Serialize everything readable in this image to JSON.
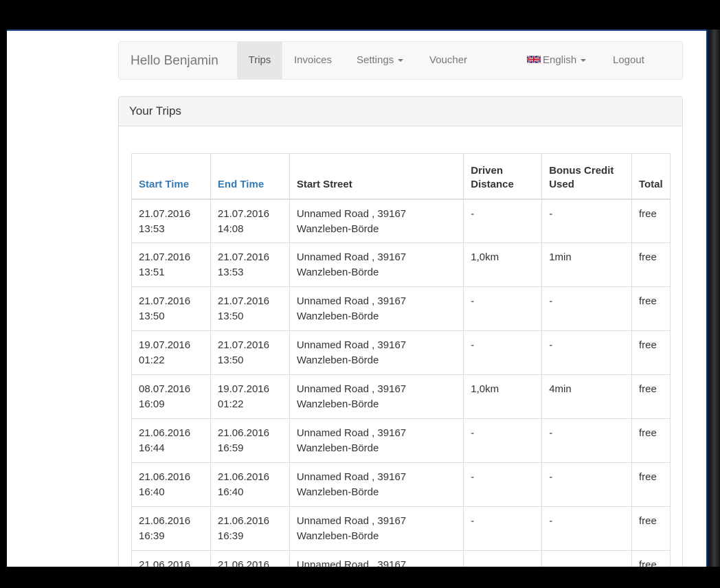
{
  "nav": {
    "brand": "Hello Benjamin",
    "trips": "Trips",
    "invoices": "Invoices",
    "settings": "Settings",
    "voucher": "Voucher",
    "language": "English",
    "logout": "Logout",
    "language_icon": "uk-flag-icon"
  },
  "panel": {
    "title": "Your Trips"
  },
  "table": {
    "headers": {
      "start_time": "Start Time",
      "end_time": "End Time",
      "start_street": "Start Street",
      "driven_1": "Driven",
      "driven_2": "Distance",
      "bonus_1": "Bonus Credit",
      "bonus_2": "Used",
      "total": "Total"
    },
    "rows": [
      {
        "start_date": "21.07.2016",
        "start_time": "13:53",
        "end_date": "21.07.2016",
        "end_time": "14:08",
        "street_1": "Unnamed Road , 39167",
        "street_2": "Wanzleben-Börde",
        "distance": "-",
        "bonus": "-",
        "total": "free"
      },
      {
        "start_date": "21.07.2016",
        "start_time": "13:51",
        "end_date": "21.07.2016",
        "end_time": "13:53",
        "street_1": "Unnamed Road , 39167",
        "street_2": "Wanzleben-Börde",
        "distance": "1,0km",
        "bonus": "1min",
        "total": "free"
      },
      {
        "start_date": "21.07.2016",
        "start_time": "13:50",
        "end_date": "21.07.2016",
        "end_time": "13:50",
        "street_1": "Unnamed Road , 39167",
        "street_2": "Wanzleben-Börde",
        "distance": "-",
        "bonus": "-",
        "total": "free"
      },
      {
        "start_date": "19.07.2016",
        "start_time": "01:22",
        "end_date": "21.07.2016",
        "end_time": "13:50",
        "street_1": "Unnamed Road , 39167",
        "street_2": "Wanzleben-Börde",
        "distance": "-",
        "bonus": "-",
        "total": "free"
      },
      {
        "start_date": "08.07.2016",
        "start_time": "16:09",
        "end_date": "19.07.2016",
        "end_time": "01:22",
        "street_1": "Unnamed Road , 39167",
        "street_2": "Wanzleben-Börde",
        "distance": "1,0km",
        "bonus": "4min",
        "total": "free"
      },
      {
        "start_date": "21.06.2016",
        "start_time": "16:44",
        "end_date": "21.06.2016",
        "end_time": "16:59",
        "street_1": "Unnamed Road , 39167",
        "street_2": "Wanzleben-Börde",
        "distance": "-",
        "bonus": "-",
        "total": "free"
      },
      {
        "start_date": "21.06.2016",
        "start_time": "16:40",
        "end_date": "21.06.2016",
        "end_time": "16:40",
        "street_1": "Unnamed Road , 39167",
        "street_2": "Wanzleben-Börde",
        "distance": "-",
        "bonus": "-",
        "total": "free"
      },
      {
        "start_date": "21.06.2016",
        "start_time": "16:39",
        "end_date": "21.06.2016",
        "end_time": "16:39",
        "street_1": "Unnamed Road , 39167",
        "street_2": "Wanzleben-Börde",
        "distance": "-",
        "bonus": "-",
        "total": "free"
      },
      {
        "start_date": "21.06.2016",
        "start_time": "",
        "end_date": "21.06.2016",
        "end_time": "",
        "street_1": "Unnamed Road , 39167",
        "street_2": "",
        "distance": "",
        "bonus": "",
        "total": "free"
      }
    ]
  },
  "colors": {
    "link": "#337ab7",
    "navbar_bg": "#f8f8f8",
    "active_tab_bg": "#e7e7e7",
    "panel_heading_bg": "#f5f5f5",
    "border": "#dddddd"
  }
}
